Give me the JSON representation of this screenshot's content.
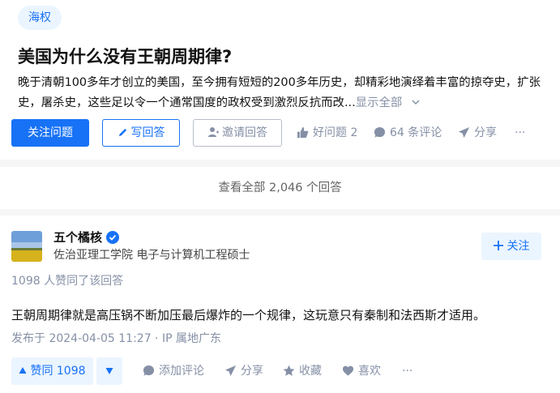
{
  "question": {
    "topic": "海权",
    "title": "美国为什么没有王朝周期律?",
    "excerpt": "晚于清朝100多年才创立的美国，至今拥有短短的200多年历史，却精彩地演绎着丰富的掠夺史，扩张史，屠杀史，这些足以令一个通常国度的政权受到激烈反抗而改...",
    "show_all": "显示全部",
    "follow_label": "关注问题",
    "write_label": "写回答",
    "invite_label": "邀请回答",
    "good_question": "好问题 2",
    "comments": "64 条评论",
    "share": "分享",
    "more": "···"
  },
  "view_all_answers": "查看全部 2,046 个回答",
  "answer": {
    "author": {
      "name": "五个橘核",
      "bio": "佐治亚理工学院 电子与计算机工程硕士",
      "follow_label": "关注"
    },
    "vote_summary": "1098 人赞同了该回答",
    "content": "王朝周期律就是高压锅不断加压最后爆炸的一个规律，这玩意只有秦制和法西斯才适用。",
    "published": "发布于 2024-04-05 11:27 · IP 属地广东",
    "upvote_label": "赞同 1098",
    "add_comment": "添加评论",
    "share": "分享",
    "collect": "收藏",
    "like": "喜欢",
    "more": "···"
  },
  "colors": {
    "accent": "#1772f6",
    "accent_light": "#ebf5ff",
    "muted": "#8590a6"
  }
}
